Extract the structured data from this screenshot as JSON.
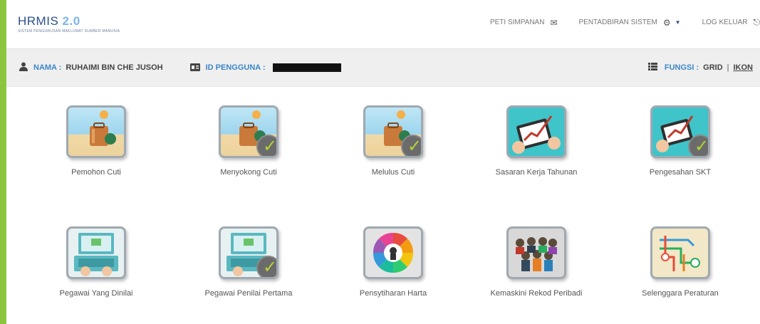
{
  "header": {
    "logo_title": "HRMIS",
    "logo_version": "2.0",
    "logo_subtitle": "SISTEM PENGURUSAN MAKLUMAT SUMBER MANUSIA",
    "nav": {
      "peti_simpanan": "PETI SIMPANAN",
      "pentadbiran_sistem": "PENTADBIRAN SISTEM",
      "log_keluar": "LOG KELUAR"
    }
  },
  "infobar": {
    "nama_label": "NAMA :",
    "nama_value": "RUHAIMI BIN CHE JUSOH",
    "id_label": "ID PENGGUNA :",
    "fungsi_label": "FUNGSI :",
    "fungsi_grid": "GRID",
    "fungsi_separator": "|",
    "fungsi_ikon": "IKON"
  },
  "tiles": [
    {
      "label": "Pemohon Cuti",
      "image": "luggage-beach",
      "checked": false
    },
    {
      "label": "Menyokong Cuti",
      "image": "luggage-beach",
      "checked": true
    },
    {
      "label": "Melulus Cuti",
      "image": "luggage-beach",
      "checked": true
    },
    {
      "label": "Sasaran Kerja Tahunan",
      "image": "tablet-chart",
      "checked": false
    },
    {
      "label": "Pengesahan SKT",
      "image": "tablet-chart",
      "checked": true
    },
    {
      "label": "Pegawai Yang Dinilai",
      "image": "laptop-hands",
      "checked": false
    },
    {
      "label": "Pegawai Penilai Pertama",
      "image": "laptop-hands",
      "checked": true
    },
    {
      "label": "Pensytiharan Harta",
      "image": "color-wheel",
      "checked": false
    },
    {
      "label": "Kemaskini Rekod Peribadi",
      "image": "group-people",
      "checked": false
    },
    {
      "label": "Selenggara Peraturan",
      "image": "flow-map",
      "checked": false
    }
  ],
  "colors": {
    "accent_green": "#8cc63f",
    "label_blue": "#3b86c8",
    "check_green": "#b5d334"
  }
}
